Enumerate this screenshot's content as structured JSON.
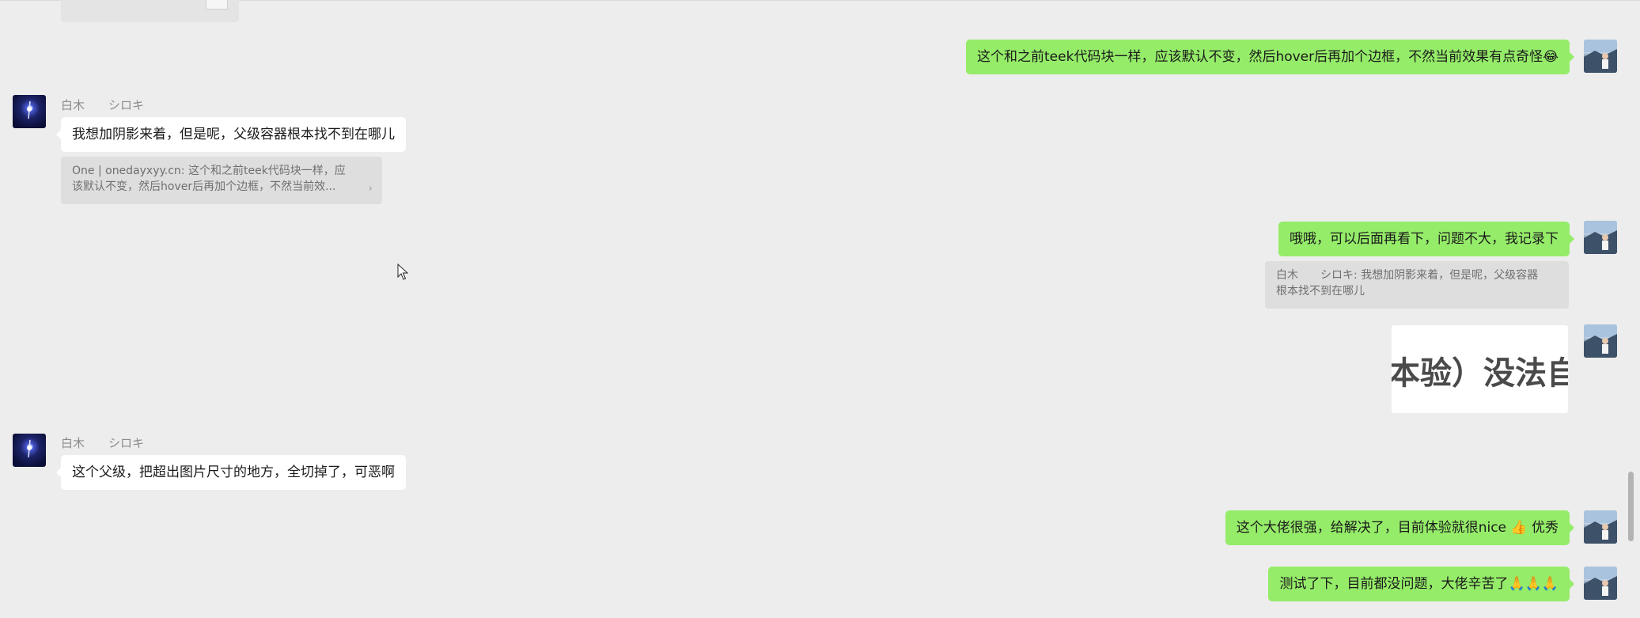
{
  "messages": [
    {
      "id": "m1",
      "direction": "out",
      "text": "这个和之前teek代码块一样，应该默认不变，然后hover后再加个边框，不然当前效果有点奇怪😂"
    },
    {
      "id": "m2",
      "direction": "in",
      "sender": "白木　　シロキ",
      "text": "我想加阴影来着，但是呢，父级容器根本找不到在哪儿",
      "quote": {
        "line1": "One | onedayxyy.cn: 这个和之前teek代码块一样，应",
        "line2": "该默认不变，然后hover后再加个边框，不然当前效...",
        "chevron": "›"
      }
    },
    {
      "id": "m3",
      "direction": "out",
      "text": "哦哦，可以后面再看下，问题不大，我记录下",
      "quote": {
        "line1": "白木　　シロキ: 我想加阴影来着，但是呢，父级容器",
        "line2": "根本找不到在哪儿"
      }
    },
    {
      "id": "m4",
      "direction": "out",
      "image_text": "本验）没法自动"
    },
    {
      "id": "m5",
      "direction": "in",
      "sender": "白木　　シロキ",
      "text": "这个父级，把超出图片尺寸的地方，全切掉了，可恶啊"
    },
    {
      "id": "m6",
      "direction": "out",
      "text": "这个大佬很强，给解决了，目前体验就很nice 👍 优秀"
    },
    {
      "id": "m7",
      "direction": "out",
      "text": "测试了下，目前都没问题，大佬辛苦了🙏🙏🙏"
    }
  ],
  "colors": {
    "background": "#ededed",
    "outgoing_bubble": "#95ec69",
    "incoming_bubble": "#ffffff",
    "quote_background": "#dedede"
  },
  "icons": {
    "cursor": "mouse-pointer-icon"
  }
}
